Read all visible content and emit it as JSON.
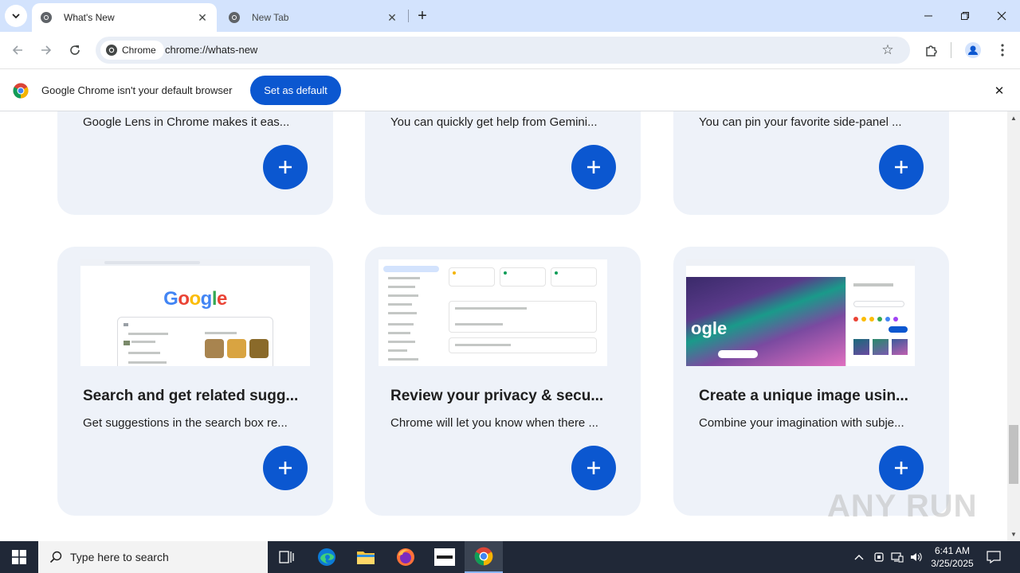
{
  "browser": {
    "tabs": [
      {
        "title": "What's New",
        "active": true
      },
      {
        "title": "New Tab",
        "active": false
      }
    ],
    "window_controls": {
      "minimize": "minimize-icon",
      "restore": "restore-icon",
      "close": "close-icon"
    },
    "toolbar": {
      "site_chip": "Chrome",
      "url": "chrome://whats-new"
    }
  },
  "infobar": {
    "message": "Google Chrome isn't your default browser",
    "button": "Set as default"
  },
  "cards_top": [
    {
      "text": "Google Lens in Chrome makes it eas..."
    },
    {
      "text": "You can quickly get help from Gemini..."
    },
    {
      "text": "You can pin your favorite side-panel ..."
    }
  ],
  "cards_bottom": [
    {
      "title": "Search and get related sugg...",
      "text": "Get suggestions in the search box re...",
      "shot_logo": "Google"
    },
    {
      "title": "Review your privacy & secu...",
      "text": "Chrome will let you know when there ..."
    },
    {
      "title": "Create a unique image usin...",
      "text": "Combine your imagination with subje...",
      "shot_logo": "ogle"
    }
  ],
  "watermark": "ANY RUN",
  "taskbar": {
    "search_placeholder": "Type here to search",
    "time": "6:41 AM",
    "date": "3/25/2025"
  },
  "colors": {
    "accent": "#0b57d0",
    "tabstrip": "#d3e3fd",
    "card": "#eef2f9",
    "taskbar": "#202837"
  }
}
